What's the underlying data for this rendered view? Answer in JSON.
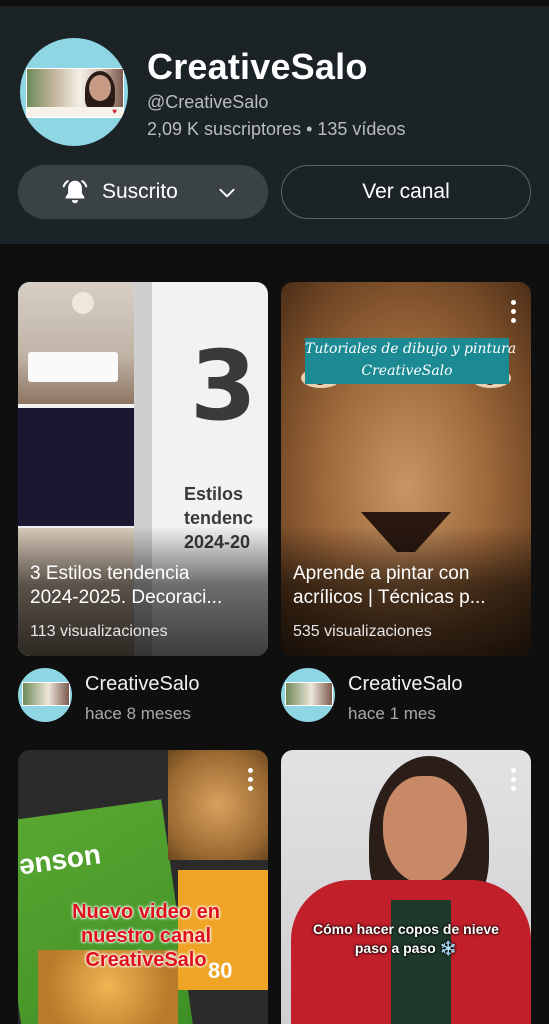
{
  "channel": {
    "name": "CreativeSalo",
    "handle": "@CreativeSalo",
    "stats": "2,09 K suscriptores • 135 vídeos",
    "subscribed_label": "Suscrito",
    "view_channel_label": "Ver canal",
    "avatar_text": "CreativeSalo"
  },
  "videos": [
    {
      "title": "3 Estilos tendencia\n2024-2025. Decoraci...",
      "views": "113 visualizaciones",
      "thumb_big": "3",
      "thumb_text": "Estilos\ntendenc\n2024-20",
      "channel": "CreativeSalo",
      "time": "hace 8 meses"
    },
    {
      "title": "Aprende a pintar con\nacrílicos | Técnicas p...",
      "views": "535 visualizaciones",
      "thumb_tag_line1": "Tutoriales de dibujo y pintura",
      "thumb_tag_line2": "CreativeSalo",
      "channel": "CreativeSalo",
      "time": "hace 1 mes"
    },
    {
      "thumb_brand": "ənson",
      "thumb_number": "80",
      "thumb_text": "Nuevo video en\nnuestro canal\nCreativeSalo"
    },
    {
      "thumb_text": "Cómo hacer copos de nieve\npaso a paso ❄️"
    }
  ],
  "colors": {
    "header_bg": "#1c2327",
    "page_bg": "#0f0f0f",
    "avatar_bg": "#8fd6e4",
    "tag_bg": "#1b8a93",
    "red_text": "#e0101a"
  }
}
